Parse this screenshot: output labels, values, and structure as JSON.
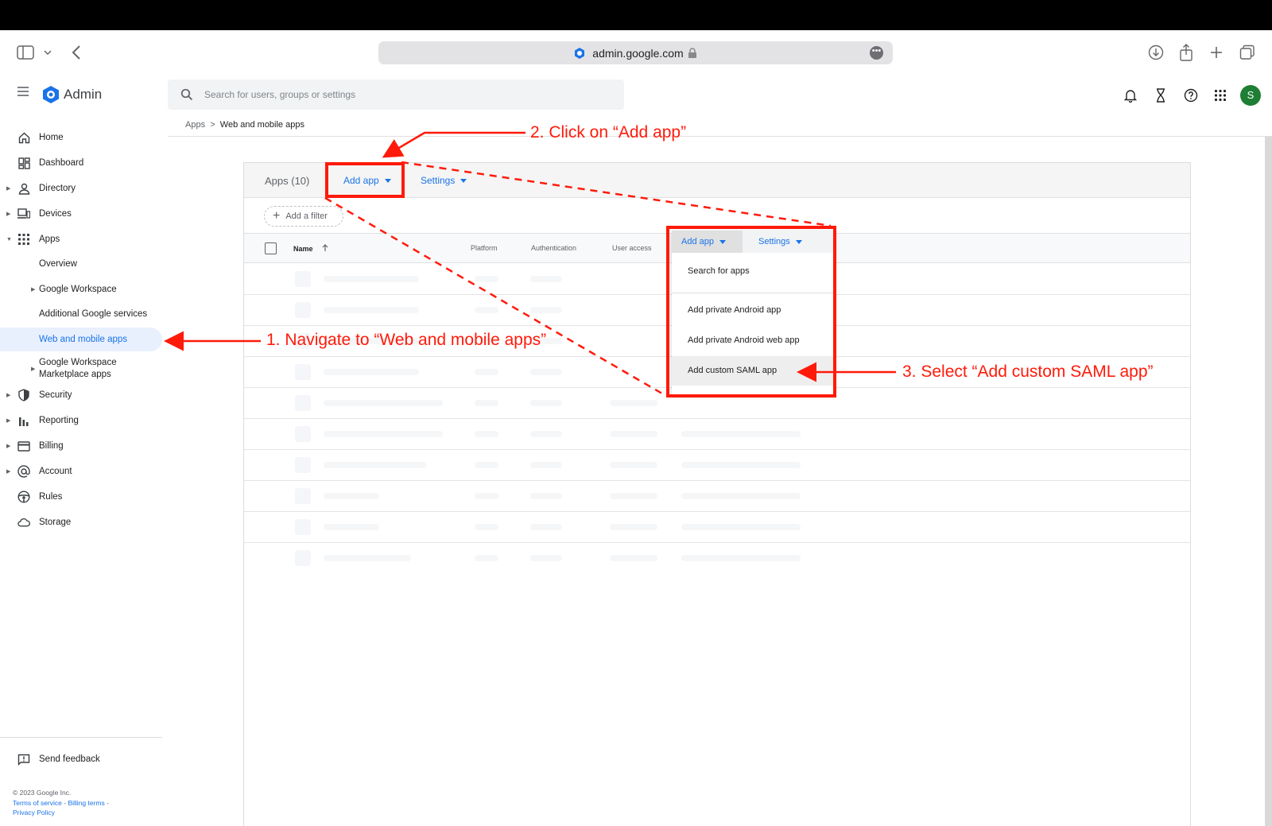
{
  "browser": {
    "url": "admin.google.com",
    "more_icon": "more-horizontal-icon"
  },
  "header": {
    "app_name": "Admin",
    "search_placeholder": "Search for users, groups or settings",
    "avatar_letter": "S",
    "avatar_color": "#1e7e34"
  },
  "sidebar": {
    "items": [
      {
        "label": "Home",
        "icon": "home-icon"
      },
      {
        "label": "Dashboard",
        "icon": "dashboard-icon"
      },
      {
        "label": "Directory",
        "icon": "person-icon"
      },
      {
        "label": "Devices",
        "icon": "devices-icon"
      },
      {
        "label": "Apps",
        "icon": "apps-grid-icon"
      },
      {
        "label": "Overview"
      },
      {
        "label": "Google Workspace"
      },
      {
        "label": "Additional Google services"
      },
      {
        "label": "Web and mobile apps"
      },
      {
        "label": "Google Workspace\nMarketplace apps"
      },
      {
        "label": "Security",
        "icon": "shield-icon"
      },
      {
        "label": "Reporting",
        "icon": "bar-chart-icon"
      },
      {
        "label": "Billing",
        "icon": "credit-card-icon"
      },
      {
        "label": "Account",
        "icon": "at-sign-icon"
      },
      {
        "label": "Rules",
        "icon": "steering-wheel-icon"
      },
      {
        "label": "Storage",
        "icon": "cloud-icon"
      }
    ],
    "feedback": "Send feedback",
    "copyright": "© 2023 Google Inc.",
    "terms": "Terms of service",
    "billing_terms": "Billing terms",
    "privacy": "Privacy Policy"
  },
  "breadcrumb": {
    "parent": "Apps",
    "separator": ">",
    "current": "Web and mobile apps"
  },
  "panel": {
    "title": "Apps (10)",
    "add_app": "Add app",
    "settings": "Settings",
    "add_filter": "Add a filter",
    "columns": [
      "Name",
      "Platform",
      "Authentication",
      "User access"
    ]
  },
  "dropdown": {
    "add_app": "Add app",
    "settings": "Settings",
    "items": [
      "Search for apps",
      "Add private Android app",
      "Add private Android web app",
      "Add custom SAML app"
    ]
  },
  "annotations": {
    "step1": "1. Navigate to “Web and mobile apps”",
    "step2": "2. Click on “Add app”",
    "step3": "3. Select “Add custom SAML app”",
    "color": "#ff1a0a"
  }
}
